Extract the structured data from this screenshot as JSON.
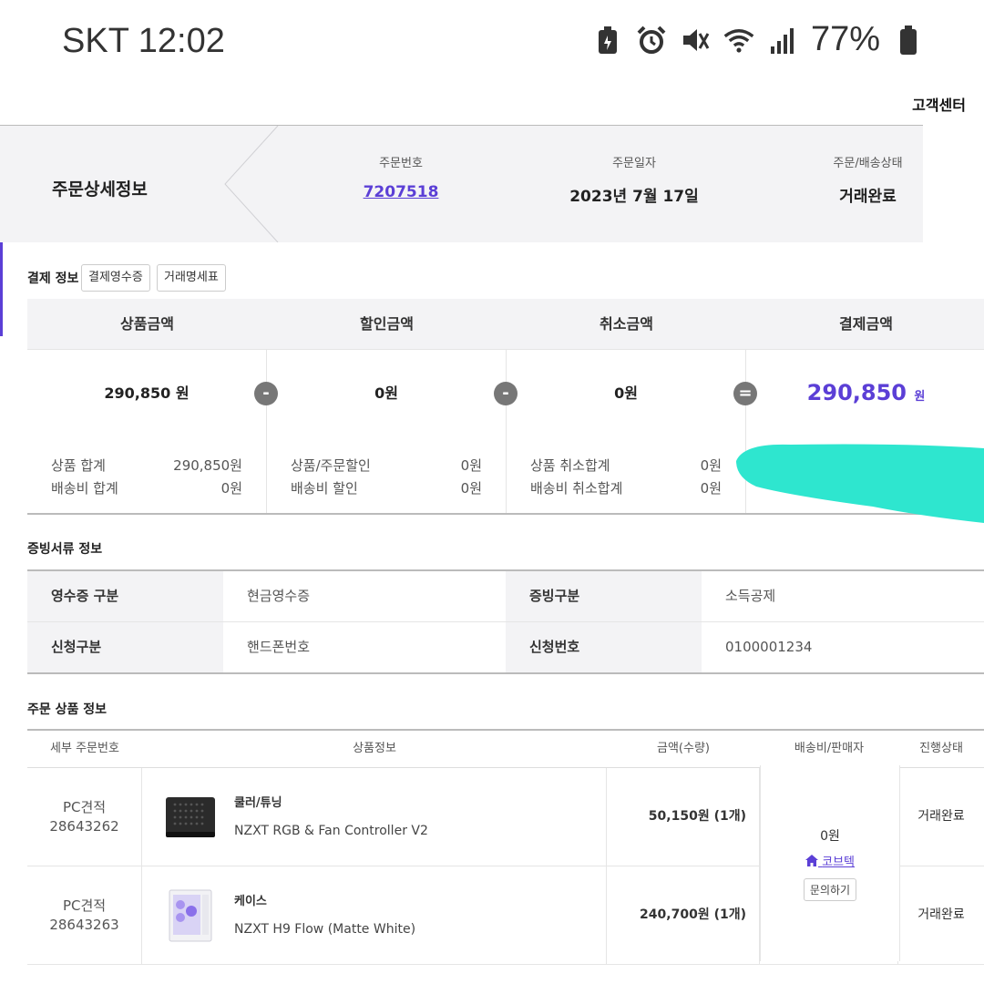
{
  "status_bar": {
    "carrier_time": "SKT 12:02",
    "battery": "77%"
  },
  "header": {
    "customer_center": "고객센터"
  },
  "banner": {
    "title": "주문상세정보",
    "order_no_label": "주문번호",
    "order_no": "7207518",
    "order_date_label": "주문일자",
    "order_date": "2023년 7월 17일",
    "status_label": "주문/배송상태",
    "status": "거래완료"
  },
  "payment": {
    "section_title": "결제 정보",
    "receipt_button": "결제영수증",
    "statement_button": "거래명세표",
    "headers": [
      "상품금액",
      "할인금액",
      "취소금액",
      "결제금액"
    ],
    "amounts": [
      "290,850 원",
      "0원",
      "0원",
      "290,850"
    ],
    "final_unit": "원",
    "operators": [
      "-",
      "-",
      "="
    ],
    "details": {
      "product_total_label": "상품 합계",
      "product_total": "290,850원",
      "shipping_total_label": "배송비 합계",
      "shipping_total": "0원",
      "order_discount_label": "상품/주문할인",
      "order_discount": "0원",
      "shipping_discount_label": "배송비 할인",
      "shipping_discount": "0원",
      "product_cancel_label": "상품 취소합계",
      "product_cancel": "0원",
      "shipping_cancel_label": "배송비 취소합계",
      "shipping_cancel": "0원"
    },
    "highlight_color": "#2ee6cf"
  },
  "evidence": {
    "section_title": "증빙서류 정보",
    "receipt_type_label": "영수증 구분",
    "receipt_type": "현금영수증",
    "evidence_type_label": "증빙구분",
    "evidence_type": "소득공제",
    "apply_type_label": "신청구분",
    "apply_type": "핸드폰번호",
    "apply_no_label": "신청번호",
    "apply_no": "0100001234"
  },
  "items": {
    "section_title": "주문 상품 정보",
    "headers": [
      "세부 주문번호",
      "상품정보",
      "금액(수량)",
      "배송비/판매자",
      "진행상태"
    ],
    "rows": [
      {
        "oid_type": "PC견적",
        "oid": "28643262",
        "category": "쿨러/튜닝",
        "name": "NZXT RGB & Fan Controller V2",
        "amount": "50,150원 (1개)",
        "status": "거래완료"
      },
      {
        "oid_type": "PC견적",
        "oid": "28643263",
        "category": "케이스",
        "name": "NZXT H9 Flow (Matte White)",
        "amount": "240,700원 (1개)",
        "status": "거래완료"
      }
    ],
    "shipping_fee": "0원",
    "seller": "코브텍",
    "inquiry_button": "문의하기"
  },
  "colors": {
    "accent": "#5b3fd6"
  }
}
